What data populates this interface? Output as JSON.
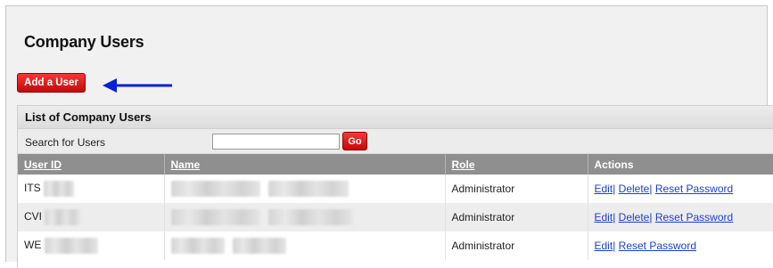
{
  "page": {
    "title": "Company Users"
  },
  "toolbar": {
    "add_user_label": "Add a User"
  },
  "annotation": {
    "arrow_color": "#0a1fd8"
  },
  "panel": {
    "title": "List of Company Users",
    "search_label": "Search for Users",
    "search_value": "",
    "go_label": "Go"
  },
  "table": {
    "columns": {
      "user_id": "User ID",
      "name": "Name",
      "role": "Role",
      "actions": "Actions"
    },
    "rows": [
      {
        "user_id_prefix": "ITS",
        "role": "Administrator",
        "edit": "Edit",
        "delete": "Delete",
        "reset": "Reset Password"
      },
      {
        "user_id_prefix": "CVI",
        "role": "Administrator",
        "edit": "Edit",
        "delete": "Delete",
        "reset": "Reset Password"
      },
      {
        "user_id_prefix": "WE",
        "role": "Administrator",
        "edit": "Edit",
        "reset": "Reset Password"
      }
    ]
  },
  "colors": {
    "button_red": "#d41414",
    "link_blue": "#1a3fcf",
    "header_gray": "#8f8f8f"
  }
}
